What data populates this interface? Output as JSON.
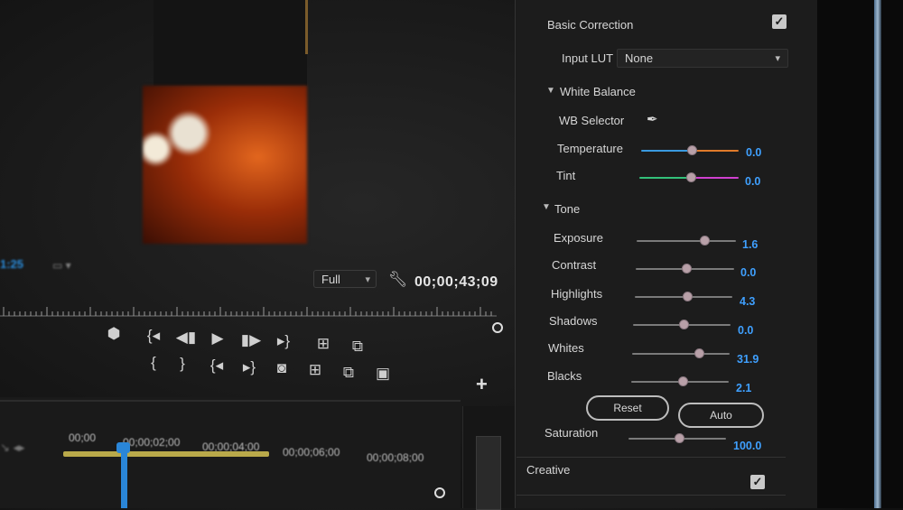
{
  "monitor": {
    "zoom": "Full",
    "timecode": "00;00;43;09",
    "left_timecode": "1:25",
    "left_icon": "fit-icon"
  },
  "transport": {
    "row1": [
      "marker-icon",
      "mark-in-icon",
      "step-back-icon",
      "play-icon",
      "step-forward-icon",
      "mark-out-icon",
      "lift-icon",
      "extract-icon"
    ],
    "row2": [
      "in-point-icon",
      "out-point-icon",
      "go-to-in-icon",
      "go-to-out-icon",
      "export-frame-icon",
      "insert-icon",
      "overwrite-icon",
      "safe-margins-icon"
    ],
    "add_label": "+"
  },
  "timeline": {
    "ticks": [
      "00;00",
      "00;00;02;00",
      "00;00;04;00",
      "00;00;06;00",
      "00;00;08;00"
    ]
  },
  "basic_correction": {
    "title": "Basic Correction",
    "enabled": true,
    "input_lut_label": "Input LUT",
    "input_lut_value": "None",
    "white_balance": {
      "title": "White Balance",
      "wb_selector_label": "WB Selector",
      "temperature": {
        "label": "Temperature",
        "value": "0.0"
      },
      "tint": {
        "label": "Tint",
        "value": "0.0"
      }
    },
    "tone": {
      "title": "Tone",
      "sliders": [
        {
          "label": "Exposure",
          "value": "1.6"
        },
        {
          "label": "Contrast",
          "value": "0.0"
        },
        {
          "label": "Highlights",
          "value": "4.3"
        },
        {
          "label": "Shadows",
          "value": "0.0"
        },
        {
          "label": "Whites",
          "value": "31.9"
        },
        {
          "label": "Blacks",
          "value": "2.1"
        }
      ],
      "reset_label": "Reset",
      "auto_label": "Auto"
    },
    "saturation": {
      "label": "Saturation",
      "value": "100.0"
    }
  },
  "creative": {
    "title": "Creative",
    "enabled": true
  },
  "colors": {
    "accent_value": "#3fa0ff",
    "timeline_bar": "#b9a94a",
    "playhead": "#2a86d8"
  }
}
